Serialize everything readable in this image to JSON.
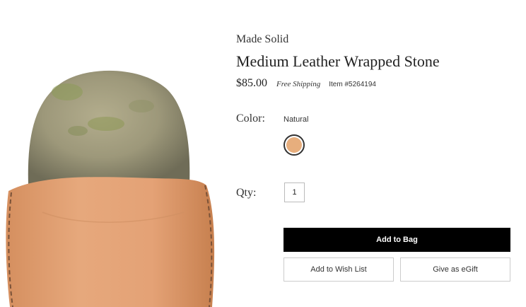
{
  "product": {
    "brand": "Made Solid",
    "title": "Medium Leather Wrapped Stone",
    "price": "$85.00",
    "shipping": "Free Shipping",
    "item_number": "Item #5264194"
  },
  "color": {
    "label": "Color:",
    "selected": "Natural",
    "swatch_color": "#E7AE7D"
  },
  "quantity": {
    "label": "Qty:",
    "value": "1"
  },
  "actions": {
    "add_to_bag": "Add to Bag",
    "wish_list": "Add to Wish List",
    "egift": "Give as eGift"
  },
  "colors": {
    "leather": "#E2A57A",
    "stone": "#9C9779",
    "button_dark": "#000000"
  }
}
